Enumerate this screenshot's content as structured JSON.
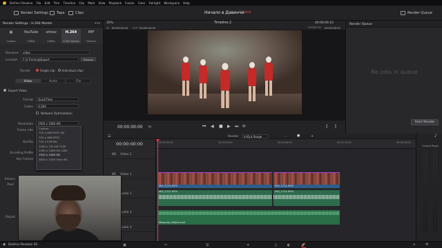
{
  "menubar": [
    "DaVinci Resolve",
    "File",
    "Edit",
    "Trim",
    "Timeline",
    "Clip",
    "Mark",
    "View",
    "Playback",
    "Fusion",
    "Color",
    "Fairlight",
    "Workspace",
    "Help"
  ],
  "toolbar": {
    "render_settings": "Render Settings",
    "tape": "Tape",
    "clips": "Clips",
    "project_title": "Начало в Давинчи",
    "project_status": "Edited",
    "render_queue": "Render Queue"
  },
  "render_panel": {
    "title": "Render Settings - H.264 Master",
    "presets": [
      {
        "logo": "",
        "label": "Custom"
      },
      {
        "logo": "YouTube",
        "label": "1080p"
      },
      {
        "logo": "vimeo",
        "label": "1080p"
      },
      {
        "logo": "H.264",
        "label": "H.264 Master"
      },
      {
        "logo": "IMF",
        "label": "Generic"
      }
    ],
    "filename_label": "Filename",
    "filename_value": "video",
    "location_label": "Location",
    "location_value": "F:\\4 Training\\Export",
    "browse_label": "Browse",
    "render_label": "Render",
    "single_clip": "Single clip",
    "individual_clips": "Individual clips",
    "subtabs": [
      "Video",
      "Audio",
      "File"
    ],
    "export_video": "Export Video",
    "format_label": "Format",
    "format_value": "QuickTime",
    "codec_label": "Codec",
    "codec_value": "H.264",
    "network_opt": "Network Optimization",
    "resolution_label": "Resolution",
    "resolution_value": "1920 x 1080 HD",
    "frame_rate_label": "Frame rate",
    "quality_label": "Quality",
    "encoding_label": "Encoding Profile",
    "key_frames_label": "Key Frames",
    "resolution_options": [
      "Custom",
      "720 x 486 NTSC DV",
      "720 x 486 NTSC",
      "720 x 576 PAL",
      "1280 x 720 HD 720P",
      "1280 x 1080 HD 1280",
      "1920 x 1080 HD",
      "3840 x 2160 Ultra HD"
    ],
    "partial_labels": [
      "Advanc",
      "Pixel",
      "Output"
    ]
  },
  "viewer": {
    "zoom": "35%",
    "in_label": "IN",
    "in_tc": "00:00:00:00",
    "out_label": "OUT",
    "out_tc": "00:00:00:00",
    "timeline_name": "Timeline 2",
    "timecode_top": "00:00:00:23",
    "duration_label": "DURATION",
    "duration_tc": "00:00:00:01",
    "current_tc": "00:00:00:00"
  },
  "render_queue": {
    "title": "Render Queue",
    "empty": "No jobs in queue",
    "start_render": "Start Render"
  },
  "timeline": {
    "timecode": "00:00:00:00",
    "render_label": "Render",
    "range_value": "In/Out Range",
    "ruler_ticks": [
      "00:00:00:00",
      "00:00:04:00",
      "00:00:08:00",
      "00:00:12:00",
      "00:00:16:00"
    ],
    "tracks": [
      {
        "id": "V2",
        "name": "Video 2"
      },
      {
        "id": "V1",
        "name": "Video 1"
      },
      {
        "id": "A1",
        "name": "Audio 1"
      },
      {
        "id": "A2",
        "name": "Audio 2"
      },
      {
        "id": "A3",
        "name": "Audio 3"
      }
    ],
    "clip_labels": {
      "v1_left": "MVI_1212.MOV",
      "v1_right": "MVI_1212.MOV",
      "a1_left": "MVI_1212.MOV",
      "a1_right": "MVI_1212.MOV",
      "a3": "Mosquito_Mojito.mp3"
    },
    "mixer_title": "Control Room"
  },
  "pagebar": {
    "app_name": "DaVinci Resolve 16",
    "pages": [
      "media-page-icon",
      "cut-page-icon",
      "edit-page-icon",
      "fusion-page-icon",
      "color-page-icon",
      "fairlight-page-icon",
      "deliver-page-icon"
    ]
  },
  "colors": {
    "accent_red": "#e34a3f",
    "clip_blue": "#2d5d8a",
    "audio_green": "#2e6b4c"
  }
}
